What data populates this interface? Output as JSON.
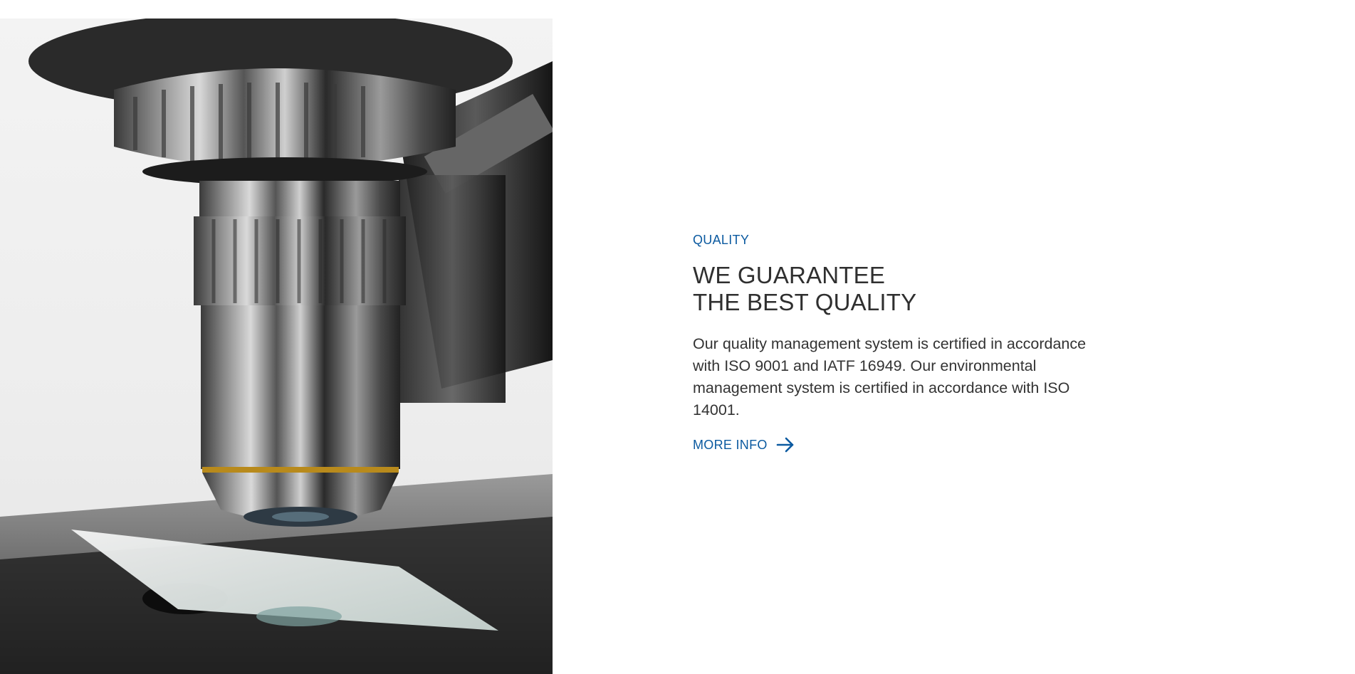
{
  "section": {
    "eyebrow": "QUALITY",
    "headline_line1": "WE GUARANTEE",
    "headline_line2": "THE BEST QUALITY",
    "body": "Our quality management system is certified in accordance with ISO 9001 and IATF 16949. Our environmental management system is certified in accordance with ISO 14001.",
    "cta_label": "MORE INFO",
    "cta_icon": "arrow-right-icon"
  },
  "image": {
    "subject": "microscope-objective-lens-image"
  },
  "colors": {
    "accent": "#0b5aa0",
    "heading": "#2f2f2f",
    "body": "#333333",
    "background": "#ffffff"
  }
}
